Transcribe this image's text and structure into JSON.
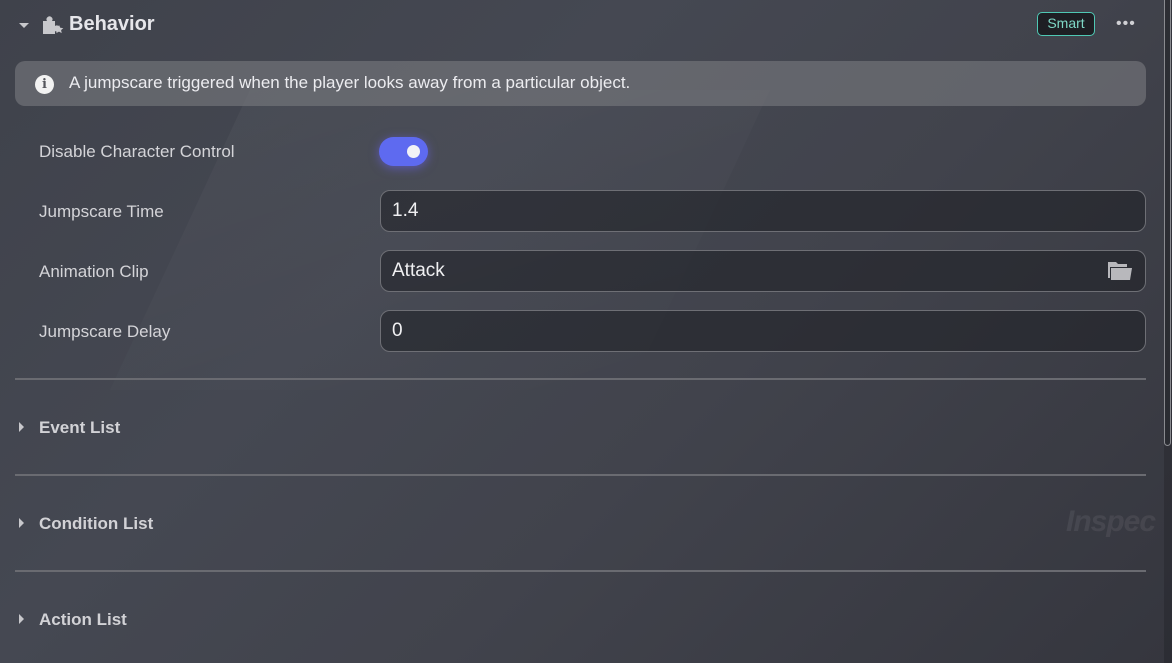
{
  "header": {
    "title": "Behavior",
    "icon": "puzzle-star-icon",
    "badge": "Smart",
    "badge_color": "#4fc8b4",
    "more_label": "•••"
  },
  "info": {
    "icon": "info-icon",
    "icon_glyph": "i",
    "text": "A jumpscare triggered when the player looks away from a particular object."
  },
  "properties": {
    "disable_character_control": {
      "label": "Disable Character Control",
      "value": true
    },
    "jumpscare_time": {
      "label": "Jumpscare Time",
      "value": "1.4"
    },
    "animation_clip": {
      "label": "Animation Clip",
      "value": "Attack",
      "icon": "folder-icon"
    },
    "jumpscare_delay": {
      "label": "Jumpscare Delay",
      "value": "0"
    }
  },
  "sections": [
    {
      "label": "Event List",
      "expanded": false
    },
    {
      "label": "Condition List",
      "expanded": false
    },
    {
      "label": "Action List",
      "expanded": false
    }
  ],
  "watermark": "Inspec",
  "accent_color": "#5e6af0"
}
